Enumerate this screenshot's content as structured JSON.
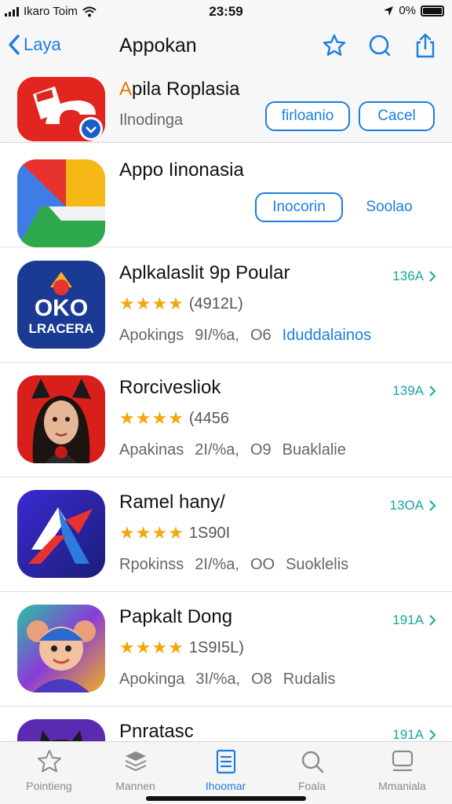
{
  "status": {
    "carrier": "Ikaro Toim",
    "time": "23:59",
    "battery": "0%"
  },
  "nav": {
    "back_label": "Laya",
    "title": "Appokan"
  },
  "featured": [
    {
      "name_first": "A",
      "name_rest": "pila Roplasia",
      "subtitle": "Ilnodinga",
      "buttons": [
        "firloanio",
        "Cacel"
      ]
    },
    {
      "name": "Appo Iinonasia",
      "buttons": [
        "Inocorin",
        "Soolao"
      ]
    }
  ],
  "apps": [
    {
      "name": "Aplkalaslit 9p Poular",
      "stars": "★★★★",
      "count": "(4912L)",
      "meta": [
        "Apokings",
        "9I/%a,",
        "O6"
      ],
      "category": "Iduddalainos",
      "category_link": true,
      "price": "136A"
    },
    {
      "name": "Rorcivesliok",
      "stars": "★★★★",
      "count": "(4456",
      "meta": [
        "Apakinas",
        "2I/%a,",
        "O9"
      ],
      "category": "Buaklalie",
      "category_link": false,
      "price": "139A"
    },
    {
      "name": "Ramel hany/",
      "stars": "★★★★",
      "count": "1S90I",
      "meta": [
        "Rpokinss",
        "2I/%a,",
        "OO"
      ],
      "category": "Suoklelis",
      "category_link": false,
      "price": "13OA"
    },
    {
      "name": "Papkalt Dong",
      "stars": "★★★★",
      "count": "1S9I5L)",
      "meta": [
        "Apokinga",
        "3I/%a,",
        "O8"
      ],
      "category": "Rudalis",
      "category_link": false,
      "price": "191A"
    },
    {
      "name": "Pnratasc",
      "price": "191A"
    }
  ],
  "tabs": [
    {
      "label": "Pointieng",
      "icon": "star-icon"
    },
    {
      "label": "Mannen",
      "icon": "stack-icon"
    },
    {
      "label": "Ihoomar",
      "icon": "list-icon"
    },
    {
      "label": "Foala",
      "icon": "search-icon"
    },
    {
      "label": "Mmaniala",
      "icon": "tray-icon"
    }
  ],
  "active_tab": 2,
  "colors": {
    "accent": "#1a7fe0",
    "price": "#1aa5a0",
    "star": "#f5a60a"
  }
}
